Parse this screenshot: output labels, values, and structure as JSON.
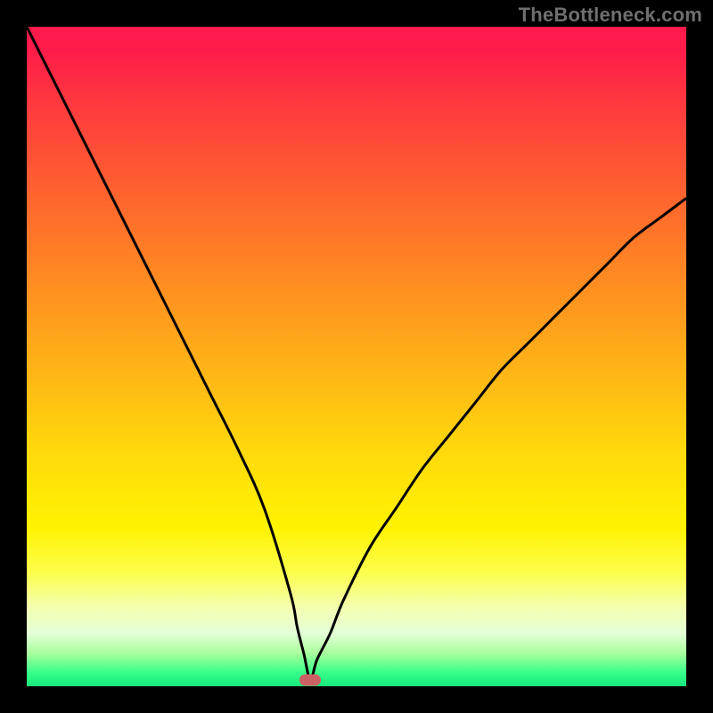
{
  "watermark": "TheBottleneck.com",
  "colors": {
    "frame": "#000000",
    "gradient_top": "#fe1a4a",
    "gradient_bottom": "#17e87a",
    "curve": "#000000",
    "marker": "#cb6162"
  },
  "chart_data": {
    "type": "line",
    "title": "",
    "xlabel": "",
    "ylabel": "",
    "xlim": [
      0,
      100
    ],
    "ylim": [
      0,
      100
    ],
    "grid": false,
    "legend": false,
    "annotations": [
      {
        "type": "marker",
        "x": 43,
        "y": 1
      }
    ],
    "series": [
      {
        "name": "bottleneck-curve",
        "x": [
          0,
          4,
          8,
          12,
          16,
          20,
          24,
          28,
          32,
          36,
          40,
          41,
          42,
          43,
          44,
          46,
          48,
          52,
          56,
          60,
          64,
          68,
          72,
          76,
          80,
          84,
          88,
          92,
          96,
          100
        ],
        "y": [
          100,
          92,
          84,
          76,
          68,
          60,
          52,
          44,
          36,
          27,
          14,
          9,
          5,
          1,
          4,
          8,
          13,
          21,
          27,
          33,
          38,
          43,
          48,
          52,
          56,
          60,
          64,
          68,
          71,
          74
        ]
      }
    ]
  }
}
